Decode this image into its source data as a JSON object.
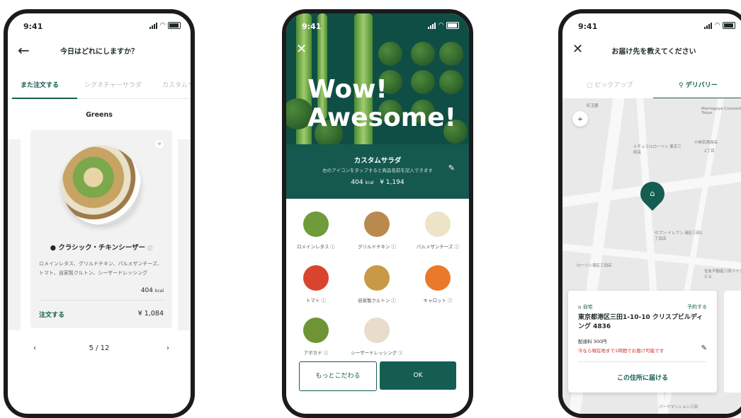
{
  "status": {
    "time": "9:41"
  },
  "screen1": {
    "title": "今日はどれにしますか？",
    "tabs": [
      "また注文する",
      "シグネチャーサラダ",
      "カスタムサ"
    ],
    "section": "Greens",
    "card": {
      "name": "クラシック・チキンシーザー",
      "description": "ロメインレタス、グリルドチキン、パルメザンチーズ、トマト、自家製クルトン、シーザードレッシング",
      "kcal": "404",
      "kcal_unit": "kcal",
      "order_label": "注文する",
      "price": "¥ 1,084"
    },
    "pager": "5 / 12"
  },
  "screen2": {
    "headline_line1": "Wow!",
    "headline_line2": "Awesome!",
    "title": "カスタムサラダ",
    "subtitle": "右のアイコンをタップすると商品名前を記入できます",
    "kcal": "404",
    "kcal_unit": "kcal",
    "price": "¥ 1,194",
    "ingredients": [
      {
        "name": "ロメインレタス ⓘ",
        "color": "#6f9b3a"
      },
      {
        "name": "グリルドチキン ⓘ",
        "color": "#b98a4e"
      },
      {
        "name": "パルメザンチーズ ⓘ",
        "color": "#ede3c6"
      },
      {
        "name": "トマト ⓘ",
        "color": "#d9442f"
      },
      {
        "name": "自家製クルトン ⓘ",
        "color": "#c99a45"
      },
      {
        "name": "キャロット ⓘ",
        "color": "#ea7a2a"
      },
      {
        "name": "アボカド ⓘ",
        "color": "#6e9436"
      },
      {
        "name": "シーザードレッシング ⓘ",
        "color": "#e8dccb"
      }
    ],
    "btn_more": "もっとこだわる",
    "btn_ok": "OK"
  },
  "screen3": {
    "title": "お届け先を教えてください",
    "tab_pickup": "ピックアップ",
    "tab_delivery": "デリバリー",
    "map_labels": [
      "紅玉園",
      "Mamegoya Crescent Tokyo",
      "ナチュラルローソン 東京三田店",
      "小林百貨商店",
      "2丁目",
      "セブン-イレブン 港区三田1丁目店",
      "ローソン港区三田店",
      "住友不動産三田ツインビル",
      "パークマンション三田"
    ],
    "card": {
      "home": "自宅",
      "reserve": "予約する",
      "address": "東京都港区三田1-10-10 クリスプビルディング 4836",
      "fee": "配達料 300円",
      "note": "今なら現在地まで1時間でお届け可能です",
      "button": "この住所に届ける"
    }
  }
}
